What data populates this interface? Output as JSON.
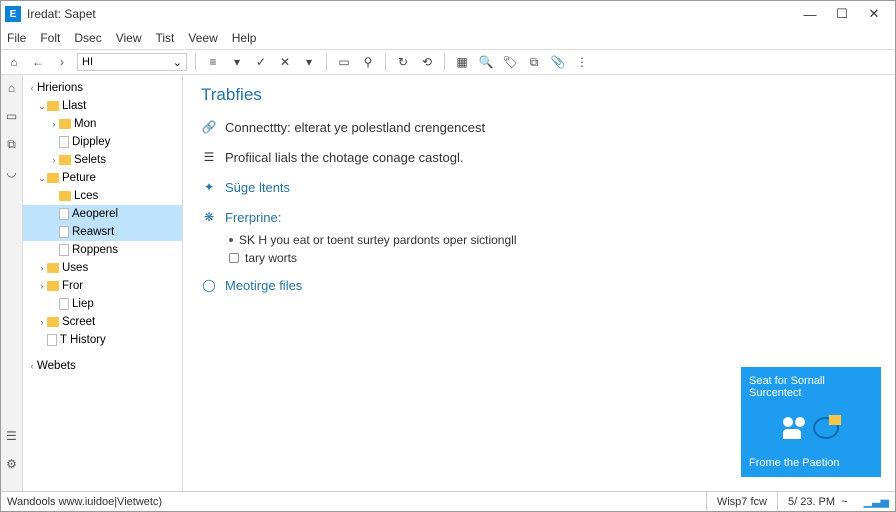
{
  "window": {
    "title": "Iredat: Sapet"
  },
  "menu": [
    "File",
    "Folt",
    "Dsec",
    "View",
    "Tist",
    "Veew",
    "Help"
  ],
  "addressbar": "HI",
  "sidebar": {
    "root1": "Hrierions",
    "llast": "Llast",
    "mon": "Mon",
    "dippley": "Dippley",
    "selets": "Selets",
    "peture": "Peture",
    "lces": "Lces",
    "aeoperel": "Aeoperel",
    "reawsrt": "Reawsrt",
    "roppens": "Roppens",
    "uses": "Uses",
    "fror": "Fror",
    "liep": "Liep",
    "screet": "Screet",
    "thistory": "T History",
    "webets": "Webets"
  },
  "page": {
    "title": "Trabfies",
    "item1": "Connecttty: elterat ye polestland crengencest",
    "item2": "Profiical lials the chotage conage castogl.",
    "item3": "Süge ltents",
    "item4": "Frerprine:",
    "sub1": "SK H you eat or toent surtey pardonts oper sictiongll",
    "sub2": "tary worts",
    "item5": "Meotirge files"
  },
  "promo": {
    "line1": "Seat for Sornall Surcentect",
    "line2": "Frome the Paetion"
  },
  "status": {
    "left": "Wandools  www.iuidoe|Vietwetc)",
    "mid": "Wisp7 fcw",
    "right": "5/ 23. PM"
  }
}
